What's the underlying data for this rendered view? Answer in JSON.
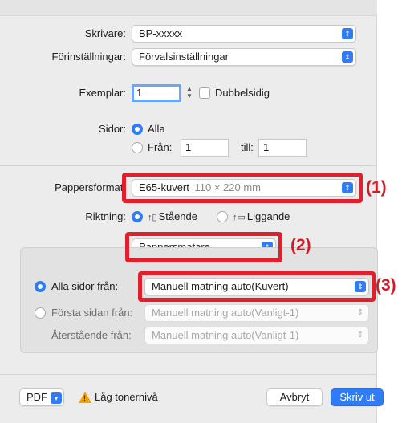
{
  "printer": {
    "label": "Skrivare:",
    "value": "BP-xxxxx"
  },
  "presets": {
    "label": "Förinställningar:",
    "value": "Förvalsinställningar"
  },
  "copies": {
    "label": "Exemplar:",
    "value": "1",
    "duplex_label": "Dubbelsidig"
  },
  "pages": {
    "label": "Sidor:",
    "all_label": "Alla",
    "from_label": "Från:",
    "from_value": "1",
    "to_label": "till:",
    "to_value": "1"
  },
  "paper_size": {
    "label": "Pappersformat:",
    "value": "E65-kuvert",
    "dimensions": "110 × 220 mm"
  },
  "orientation": {
    "label": "Riktning:",
    "portrait_label": "Stående",
    "landscape_label": "Liggande"
  },
  "section_popup": {
    "value": "Pappersmatare"
  },
  "feed": {
    "all_pages_label": "Alla sidor från:",
    "all_pages_value": "Manuell matning auto(Kuvert)",
    "first_page_label": "Första sidan från:",
    "first_page_value": "Manuell matning auto(Vanligt-1)",
    "remaining_label": "Återstående från:",
    "remaining_value": "Manuell matning auto(Vanligt-1)"
  },
  "footer": {
    "pdf_label": "PDF",
    "warning_text": "Låg tonernivå",
    "cancel_label": "Avbryt",
    "print_label": "Skriv ut"
  },
  "callouts": [
    "(1)",
    "(2)",
    "(3)"
  ],
  "colors": {
    "accent": "#2f7cf6",
    "highlight": "#e0202c",
    "callout": "#d31a26",
    "warning": "#f2a200"
  }
}
